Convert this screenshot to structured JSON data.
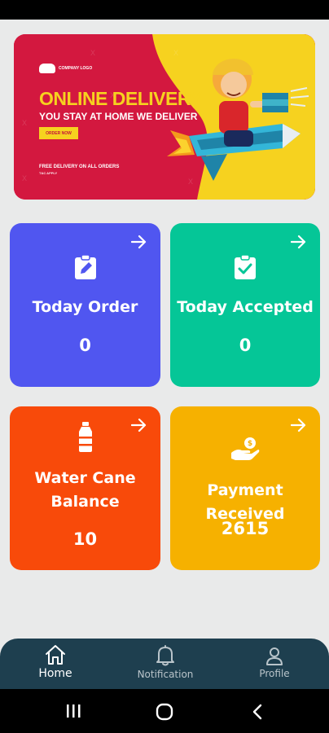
{
  "banner": {
    "logo_text": "COMPANY LOGO",
    "headline": "ONLINE DELIVERY",
    "subline": "YOU STAY AT HOME WE DELIVER",
    "button_label": "ORDER NOW",
    "footnote": "FREE DELIVERY ON ALL ORDERS",
    "footnote_small": "T&C APPLY",
    "colors": {
      "red": "#d3183f",
      "yellow": "#f6d21f"
    }
  },
  "cards": [
    {
      "title": "Today Order",
      "value": "0",
      "icon": "clipboard-edit-icon",
      "color": "#5056f0"
    },
    {
      "title": "Today Accepted",
      "value": "0",
      "icon": "clipboard-check-icon",
      "color": "#05c697"
    },
    {
      "title": "Water Cane Balance",
      "title_line1": "Water Cane",
      "title_line2": "Balance",
      "value": "10",
      "icon": "water-bottle-icon",
      "color": "#f84a0a"
    },
    {
      "title": "Payment Received",
      "value": "2615",
      "icon": "hand-coin-icon",
      "color": "#f6b100"
    }
  ],
  "bottom_nav": {
    "items": [
      {
        "label": "Home",
        "icon": "home-icon",
        "active": true
      },
      {
        "label": "Notification",
        "icon": "bell-icon",
        "active": false
      },
      {
        "label": "Profile",
        "icon": "person-icon",
        "active": false
      }
    ],
    "background": "#1e3f4f"
  },
  "system_nav": {
    "icons": [
      "recent-apps-icon",
      "home-circle-icon",
      "back-icon"
    ]
  }
}
